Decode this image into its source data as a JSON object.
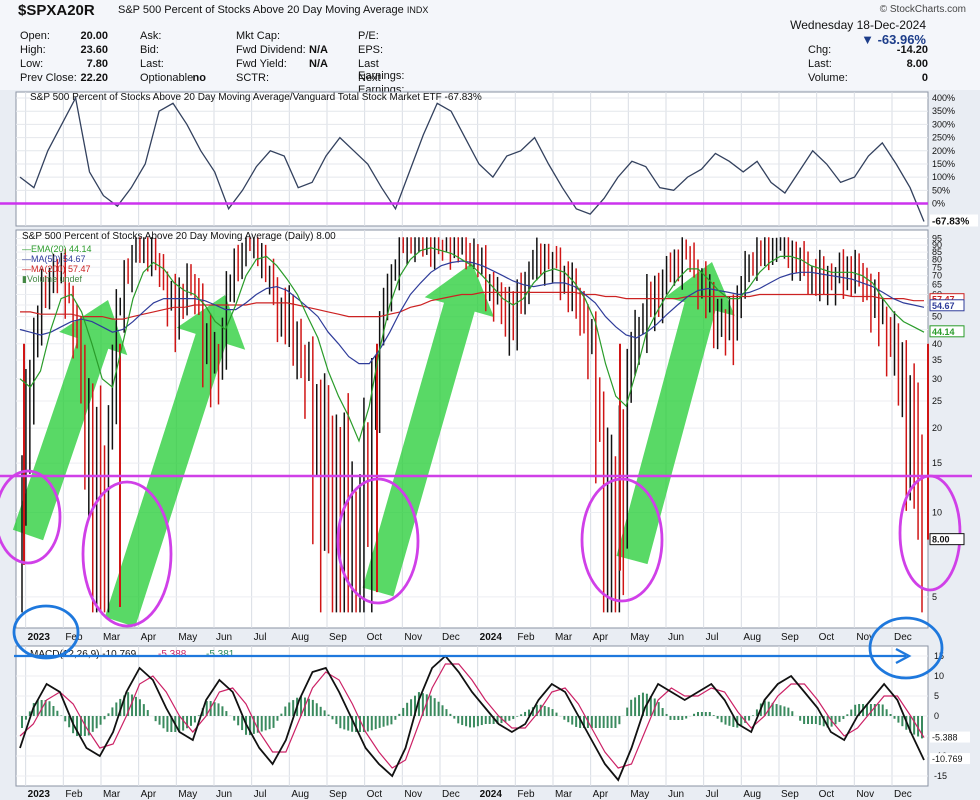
{
  "header": {
    "symbol": "$SPXA20R",
    "description": "S&P 500 Percent of Stocks Above 20 Day Moving Average",
    "exchange": "INDX",
    "brand": "© StockCharts.com",
    "date": "Wednesday  18-Dec-2024",
    "change_pct": "▼ -63.96%",
    "col1": [
      {
        "label": "Open:",
        "value": "20.00"
      },
      {
        "label": "High:",
        "value": "23.60"
      },
      {
        "label": "Low:",
        "value": "7.80"
      },
      {
        "label": "Prev Close:",
        "value": "22.20"
      }
    ],
    "col2": [
      {
        "label": "Ask:",
        "value": ""
      },
      {
        "label": "Bid:",
        "value": ""
      },
      {
        "label": "Last:",
        "value": ""
      },
      {
        "label": "Optionable",
        "value": "no"
      }
    ],
    "col3": [
      {
        "label": "Mkt Cap:",
        "value": ""
      },
      {
        "label": "Fwd Dividend:",
        "value": "N/A"
      },
      {
        "label": "Fwd Yield:",
        "value": "N/A"
      },
      {
        "label": "SCTR:",
        "value": ""
      }
    ],
    "col4": [
      {
        "label": "P/E:",
        "value": ""
      },
      {
        "label": "EPS:",
        "value": ""
      },
      {
        "label": "Last Earnings:",
        "value": ""
      },
      {
        "label": "Next Earnings:",
        "value": ""
      }
    ],
    "col5": [
      {
        "label": "Chg:",
        "value": "-14.20"
      },
      {
        "label": "Last:",
        "value": "8.00"
      },
      {
        "label": "Volume:",
        "value": "0"
      }
    ]
  },
  "chart_data": [
    {
      "type": "line",
      "title": "S&P 500 Percent of Stocks Above 20 Day Moving Average/Vanguard Total Stock Market ETF -67.83%",
      "y_ticks": [
        "400%",
        "350%",
        "300%",
        "250%",
        "200%",
        "150%",
        "100%",
        "50%",
        "0%"
      ],
      "last_value_label": "-67.83%",
      "color": "#33415e",
      "ref_line_color": "#cc33ee",
      "series": [
        {
          "values": [
            100,
            60,
            200,
            300,
            400,
            120,
            30,
            -10,
            60,
            150,
            350,
            380,
            300,
            200,
            120,
            -20,
            50,
            140,
            200,
            180,
            60,
            80,
            180,
            250,
            200,
            150,
            60,
            -20,
            120,
            260,
            380,
            350,
            250,
            150,
            100,
            180,
            200,
            250,
            150,
            60,
            -20,
            -40,
            20,
            100,
            160,
            140,
            60,
            50,
            100,
            130,
            190,
            160,
            120,
            160,
            80,
            40,
            120,
            200,
            150,
            80,
            100,
            180,
            230,
            150,
            60,
            -68
          ]
        }
      ]
    },
    {
      "type": "bar",
      "title": "S&P 500 Percent of Stocks Above 20 Day Moving Average (Daily) 8.00",
      "legend": [
        {
          "name": "EMA(20) 44.14",
          "color": "#2a9c2a"
        },
        {
          "name": "MA(50) 54.67",
          "color": "#2f3c9a"
        },
        {
          "name": "MA(200) 57.47",
          "color": "#cc2222"
        },
        {
          "name": "Volume undef",
          "color": "#448844"
        }
      ],
      "y_ticks": [
        95,
        90,
        85,
        80,
        75,
        70,
        65,
        60,
        55,
        50,
        45,
        40,
        35,
        30,
        25,
        20,
        15,
        10,
        5
      ],
      "ylim": [
        4,
        97
      ],
      "right_labels": [
        {
          "text": "57.47",
          "y": 57.47,
          "color": "#cc2222"
        },
        {
          "text": "54.67",
          "y": 54.67,
          "color": "#2f3c9a"
        },
        {
          "text": "44.14",
          "y": 44.14,
          "color": "#2a9c2a"
        },
        {
          "text": "8.00",
          "y": 8,
          "color": "#111111"
        }
      ],
      "x_labels": [
        "2023",
        "Feb",
        "Mar",
        "Apr",
        "May",
        "Jun",
        "Jul",
        "Aug",
        "Sep",
        "Oct",
        "Nov",
        "Dec",
        "2024",
        "Feb",
        "Mar",
        "Apr",
        "May",
        "Jun",
        "Jul",
        "Aug",
        "Sep",
        "Oct",
        "Nov",
        "Dec"
      ],
      "close": [
        10,
        40,
        60,
        75,
        70,
        50,
        25,
        15,
        8,
        40,
        70,
        88,
        90,
        80,
        65,
        50,
        70,
        60,
        40,
        30,
        60,
        80,
        92,
        88,
        70,
        55,
        50,
        40,
        28,
        20,
        15,
        12,
        8,
        5,
        20,
        45,
        70,
        88,
        93,
        94,
        91,
        88,
        92,
        90,
        85,
        75,
        60,
        55,
        50,
        65,
        80,
        82,
        78,
        70,
        60,
        50,
        30,
        10,
        6,
        25,
        45,
        55,
        60,
        72,
        80,
        85,
        70,
        60,
        50,
        45,
        58,
        78,
        86,
        88,
        92,
        84,
        80,
        72,
        70,
        68,
        72,
        75,
        70,
        60,
        50,
        42,
        30,
        22,
        8
      ],
      "ma20": [
        30,
        28,
        32,
        45,
        58,
        60,
        52,
        40,
        30,
        28,
        40,
        58,
        72,
        78,
        74,
        66,
        62,
        60,
        55,
        48,
        45,
        55,
        70,
        80,
        82,
        76,
        68,
        60,
        50,
        42,
        32,
        26,
        22,
        18,
        24,
        38,
        55,
        70,
        80,
        86,
        88,
        86,
        84,
        80,
        76,
        70,
        64,
        58,
        55,
        58,
        66,
        72,
        74,
        72,
        66,
        58,
        48,
        34,
        26,
        24,
        32,
        44,
        52,
        60,
        68,
        74,
        74,
        68,
        62,
        58,
        58,
        64,
        72,
        78,
        82,
        82,
        80,
        76,
        74,
        72,
        72,
        72,
        70,
        66,
        58,
        52,
        48,
        46,
        44
      ],
      "ma50": [
        45,
        44,
        43,
        44,
        46,
        48,
        49,
        48,
        46,
        44,
        45,
        48,
        52,
        56,
        58,
        58,
        58,
        58,
        57,
        55,
        53,
        53,
        56,
        60,
        63,
        64,
        62,
        58,
        54,
        50,
        44,
        40,
        36,
        34,
        34,
        38,
        44,
        52,
        60,
        66,
        72,
        76,
        78,
        79,
        78,
        76,
        73,
        70,
        67,
        65,
        64,
        65,
        66,
        66,
        64,
        60,
        56,
        50,
        46,
        43,
        42,
        44,
        47,
        51,
        55,
        59,
        62,
        63,
        62,
        61,
        60,
        61,
        63,
        66,
        69,
        71,
        72,
        72,
        71,
        70,
        69,
        68,
        66,
        64,
        61,
        58,
        56,
        55,
        54
      ],
      "ma200": [
        52,
        52,
        51,
        51,
        51,
        51,
        50,
        50,
        50,
        49,
        49,
        50,
        51,
        52,
        53,
        54,
        54,
        55,
        55,
        55,
        55,
        55,
        55,
        56,
        56,
        56,
        56,
        55,
        54,
        53,
        52,
        51,
        50,
        50,
        50,
        50,
        51,
        52,
        54,
        55,
        57,
        58,
        59,
        60,
        60,
        61,
        61,
        61,
        61,
        61,
        61,
        61,
        61,
        61,
        61,
        60,
        60,
        59,
        59,
        58,
        58,
        58,
        58,
        58,
        58,
        59,
        59,
        59,
        59,
        59,
        59,
        59,
        60,
        60,
        60,
        60,
        60,
        60,
        60,
        60,
        60,
        59,
        59,
        59,
        58,
        58,
        58,
        57,
        57
      ],
      "annotation_line_y": 13.5
    },
    {
      "type": "line",
      "title": "MACD(12,26,9) -10.769, -5.388, -5.381",
      "legend": [
        {
          "name": "MACD(12,26,9) -10.769",
          "color": "#111111"
        },
        {
          "name": "-5.388",
          "color": "#cc2266"
        },
        {
          "name": "-5.381",
          "color": "#2a8a5a"
        }
      ],
      "y_ticks": [
        15,
        10,
        5,
        0,
        -5,
        -10,
        -15
      ],
      "ylim": [
        -16,
        16
      ],
      "right_labels": [
        {
          "text": "-5.388",
          "y": -5.388
        },
        {
          "text": "-10.769",
          "y": -10.769
        }
      ],
      "x_labels": [
        "2023",
        "Feb",
        "Mar",
        "Apr",
        "May",
        "Jun",
        "Jul",
        "Aug",
        "Sep",
        "Oct",
        "Nov",
        "Dec",
        "2024",
        "Feb",
        "Mar",
        "Apr",
        "May",
        "Jun",
        "Jul",
        "Aug",
        "Sep",
        "Oct",
        "Nov",
        "Dec"
      ],
      "macd": [
        -8,
        2,
        8,
        6,
        -2,
        -8,
        -10,
        -4,
        6,
        12,
        9,
        2,
        -4,
        -6,
        4,
        9,
        6,
        -2,
        -8,
        -12,
        -6,
        4,
        11,
        12,
        6,
        -1,
        -8,
        -12,
        -15,
        -8,
        4,
        12,
        15,
        11,
        6,
        2,
        -2,
        -4,
        -2,
        4,
        8,
        6,
        0,
        -6,
        -12,
        -16,
        -8,
        2,
        8,
        6,
        4,
        6,
        8,
        4,
        -2,
        -4,
        4,
        8,
        10,
        6,
        2,
        -4,
        -6,
        0,
        4,
        8,
        4,
        -4,
        -11
      ],
      "signal": [
        -5,
        -2,
        4,
        6,
        3,
        -3,
        -8,
        -7,
        0,
        8,
        10,
        6,
        0,
        -4,
        0,
        6,
        7,
        3,
        -4,
        -9,
        -9,
        -1,
        7,
        11,
        9,
        3,
        -4,
        -9,
        -13,
        -11,
        -2,
        7,
        13,
        13,
        9,
        4,
        0,
        -3,
        -3,
        1,
        6,
        7,
        3,
        -3,
        -9,
        -13,
        -12,
        -4,
        4,
        7,
        5,
        5,
        7,
        6,
        1,
        -3,
        0,
        5,
        8,
        8,
        4,
        -1,
        -5,
        -3,
        1,
        5,
        5,
        0,
        -5.4
      ]
    }
  ],
  "annotations": {
    "magenta": "#d040e8",
    "blue": "#1e78dd",
    "green": "#22cc33"
  }
}
